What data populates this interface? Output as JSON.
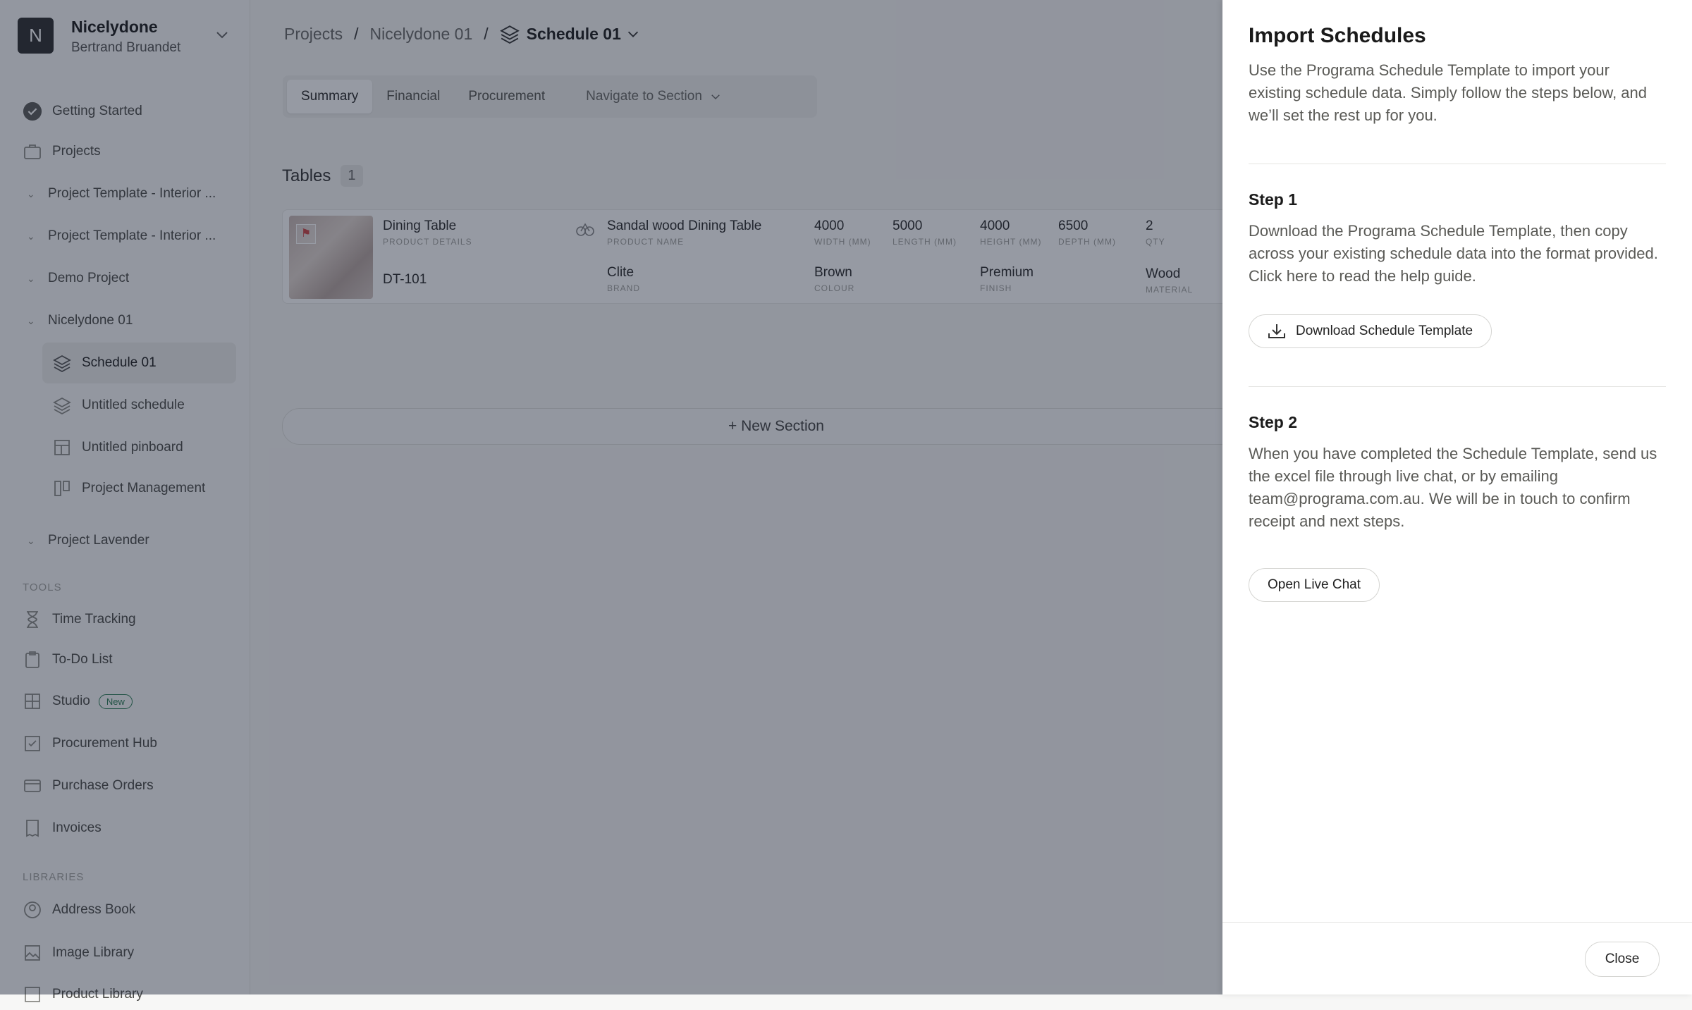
{
  "workspace": {
    "initial": "N",
    "name": "Nicelydone",
    "user": "Bertrand Bruandet"
  },
  "sidebar": {
    "getting_started": "Getting Started",
    "projects": "Projects",
    "project_items": [
      "Project Template - Interior ...",
      "Project Template - Interior ...",
      "Demo Project",
      "Nicelydone 01"
    ],
    "sub_items": [
      "Schedule 01",
      "Untitled schedule",
      "Untitled pinboard",
      "Project Management"
    ],
    "project_lavender": "Project Lavender",
    "tools_label": "TOOLS",
    "tools": [
      "Time Tracking",
      "To-Do List",
      "Studio",
      "Procurement Hub",
      "Purchase Orders",
      "Invoices"
    ],
    "studio_badge": "New",
    "libraries_label": "LIBRARIES",
    "libraries": [
      "Address Book",
      "Image Library",
      "Product Library"
    ]
  },
  "breadcrumb": {
    "projects": "Projects",
    "sep": "/",
    "project": "Nicelydone 01",
    "current": "Schedule 01"
  },
  "tabs": [
    "Summary",
    "Financial",
    "Procurement"
  ],
  "navigate": "Navigate to Section",
  "tables": {
    "label": "Tables",
    "count": "1"
  },
  "row": {
    "product_details": {
      "value": "Dining Table",
      "label": "PRODUCT DETAILS"
    },
    "code": "DT-101",
    "product_name": {
      "value": "Sandal wood Dining Table",
      "label": "PRODUCT NAME"
    },
    "brand": {
      "value": "Clite",
      "label": "BRAND"
    },
    "width": {
      "value": "4000",
      "label": "WIDTH (MM)"
    },
    "length": {
      "value": "5000",
      "label": "LENGTH (MM)"
    },
    "height": {
      "value": "4000",
      "label": "HEIGHT (MM)"
    },
    "depth": {
      "value": "6500",
      "label": "DEPTH (MM)"
    },
    "qty": {
      "value": "2",
      "label": "QTY"
    },
    "colour": {
      "value": "Brown",
      "label": "COLOUR"
    },
    "finish": {
      "value": "Premium",
      "label": "FINISH"
    },
    "material": {
      "value": "Wood",
      "label": "MATERIAL"
    }
  },
  "new_section": "+ New Section",
  "drawer": {
    "title": "Import Schedules",
    "intro": "Use the Programa Schedule Template to import your existing schedule data. Simply follow the steps below, and we’ll set the rest up for you.",
    "step1_title": "Step 1",
    "step1_text": "Download the Programa Schedule Template, then copy across your existing schedule data into the format provided. Click here to read the help guide.",
    "download_label": "Download Schedule Template",
    "step2_title": "Step 2",
    "step2_text": "When you have completed the Schedule Template, send us the excel file through live chat, or by emailing team@programa.com.au. We will be in touch to confirm receipt and next steps.",
    "chat_label": "Open Live Chat",
    "close_label": "Close"
  }
}
